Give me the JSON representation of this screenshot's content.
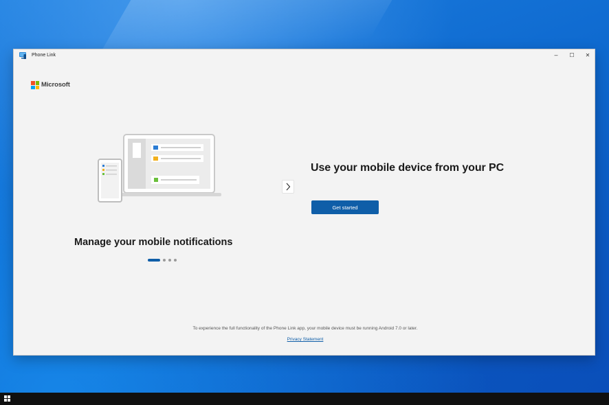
{
  "window": {
    "title": "Phone Link",
    "controls": {
      "minimize": "–",
      "maximize": "☐",
      "close": "✕"
    }
  },
  "brand": {
    "name": "Microsoft",
    "logo_colors": [
      "#f25022",
      "#7fba00",
      "#00a4ef",
      "#ffb900"
    ]
  },
  "carousel": {
    "slide_caption": "Manage your mobile notifications",
    "total_slides": 4,
    "active_slide": 1,
    "next_icon": "chevron-right-icon"
  },
  "hero": {
    "headline": "Use your mobile device from your PC",
    "cta_label": "Get started"
  },
  "footer": {
    "requirement_note": "To experience the full functionality of the Phone Link app, your mobile device must be running Android 7.0 or later.",
    "privacy_link": "Privacy Statement"
  },
  "colors": {
    "accent": "#0f5ea8",
    "window_bg": "#f3f3f3"
  }
}
